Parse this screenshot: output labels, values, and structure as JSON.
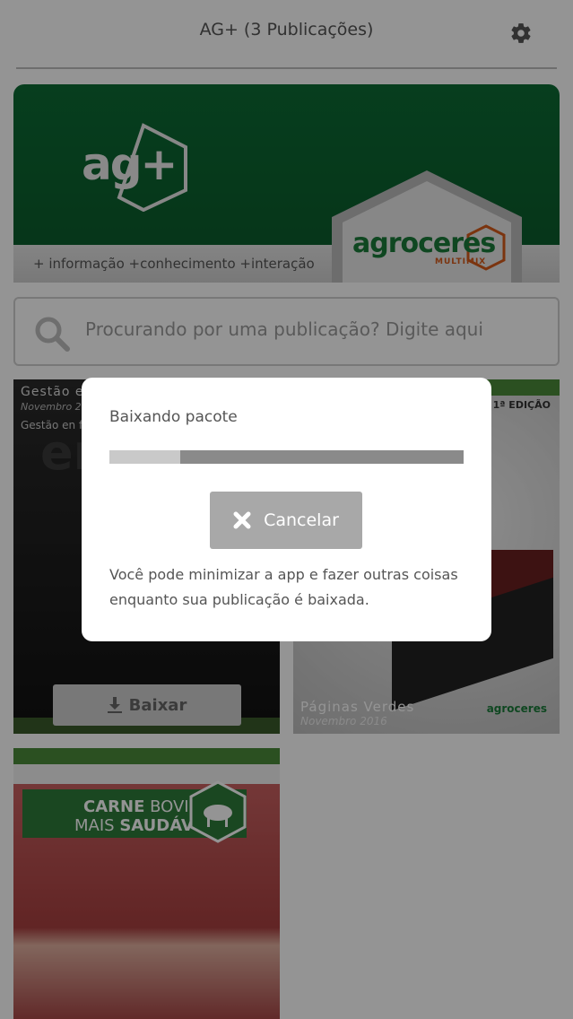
{
  "header": {
    "title": "AG+ (3 Publicações)"
  },
  "banner": {
    "logo_text": "ag+",
    "tagline": "+ informação  +conhecimento +interação",
    "brand": "agroceres",
    "brand_sub": "MULTIMIX"
  },
  "search": {
    "placeholder": "Procurando por uma publicação? Digite aqui"
  },
  "publications": [
    {
      "title": "Gestão e",
      "date": "Novembro 20",
      "subtitle": "Gestão en fo",
      "cover_text": "en fo",
      "button_label": "Baixar"
    },
    {
      "edition": "1ª EDIÇÃO",
      "title": "Páginas Verdes",
      "date": "Novembro 2016",
      "logo": "agroceres"
    },
    {
      "line1_a": "CARNE",
      "line1_b": " BOVINA",
      "line2_a": "MAIS ",
      "line2_b": "SAUDÁVEL"
    }
  ],
  "dialog": {
    "title": "Baixando pacote",
    "progress": 0.2,
    "cancel_label": "Cancelar",
    "message": "Você pode minimizar a app e fazer outras coisas enquanto sua publicação é baixada."
  },
  "colors": {
    "brand_green": "#0d6b34",
    "overlay": "rgba(0,0,0,0.42)",
    "progress_track": "#8a8a8a",
    "progress_fill": "#c9c9c9",
    "cancel_button": "#a8a8a8"
  }
}
